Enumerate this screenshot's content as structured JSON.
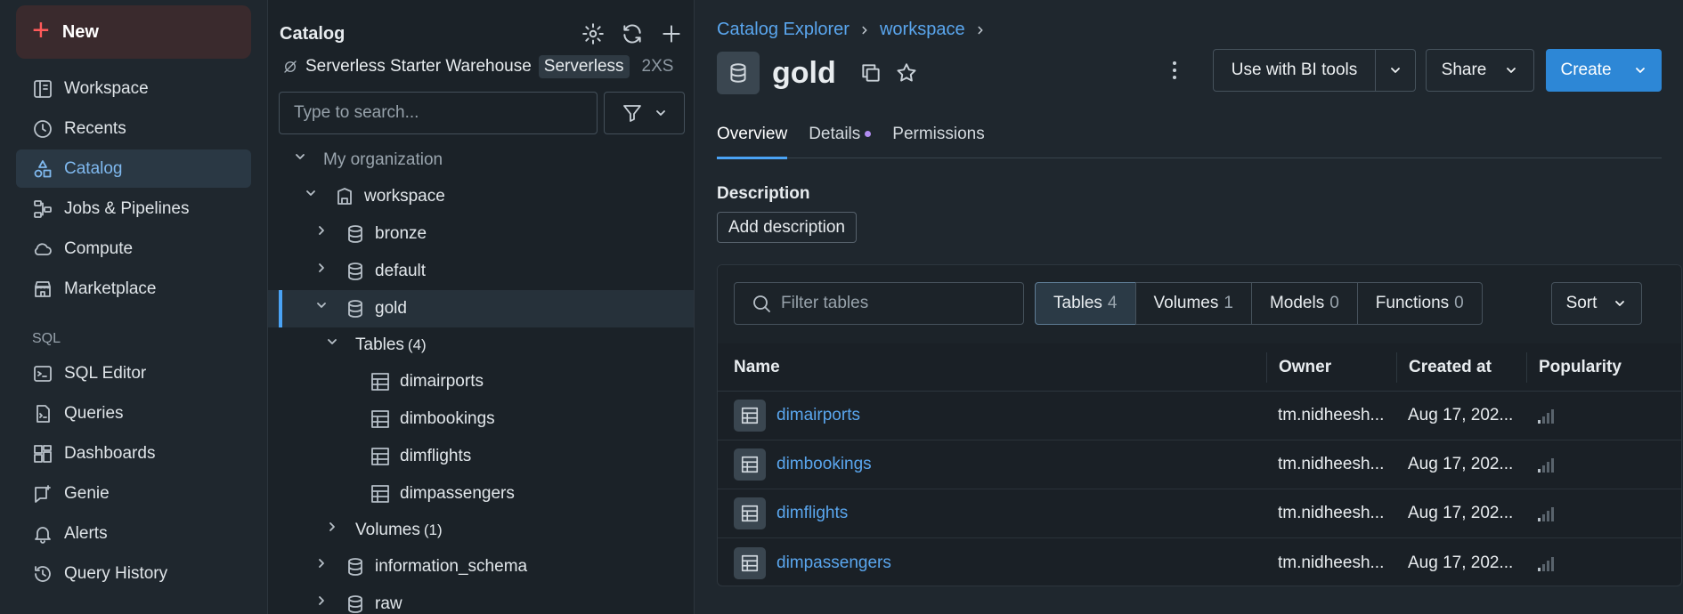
{
  "leftnav": {
    "new_label": "New",
    "items": [
      {
        "label": "Workspace",
        "icon": "workspace-icon"
      },
      {
        "label": "Recents",
        "icon": "clock-icon"
      },
      {
        "label": "Catalog",
        "icon": "catalog-icon",
        "active": true
      },
      {
        "label": "Jobs & Pipelines",
        "icon": "workflow-icon"
      },
      {
        "label": "Compute",
        "icon": "cloud-icon"
      },
      {
        "label": "Marketplace",
        "icon": "store-icon"
      }
    ],
    "sql_section": "SQL",
    "sql_items": [
      {
        "label": "SQL Editor",
        "icon": "terminal-icon"
      },
      {
        "label": "Queries",
        "icon": "file-code-icon"
      },
      {
        "label": "Dashboards",
        "icon": "dashboard-icon"
      },
      {
        "label": "Genie",
        "icon": "chat-icon"
      },
      {
        "label": "Alerts",
        "icon": "bell-icon"
      },
      {
        "label": "Query History",
        "icon": "history-icon"
      }
    ]
  },
  "catalog_panel": {
    "title": "Catalog",
    "warehouse": {
      "name": "Serverless Starter Warehouse",
      "badge": "Serverless",
      "size": "2XS"
    },
    "search_placeholder": "Type to search...",
    "tree": {
      "org": "My organization",
      "workspace": "workspace",
      "bronze": "bronze",
      "default": "default",
      "gold": "gold",
      "tables_label": "Tables",
      "tables_count": "(4)",
      "tables": [
        "dimairports",
        "dimbookings",
        "dimflights",
        "dimpassengers"
      ],
      "volumes_label": "Volumes",
      "volumes_count": "(1)",
      "information_schema": "information_schema",
      "raw": "raw"
    }
  },
  "main": {
    "breadcrumb": [
      "Catalog Explorer",
      "workspace"
    ],
    "title": "gold",
    "buttons": {
      "bi": "Use with BI tools",
      "share": "Share",
      "create": "Create"
    },
    "tabs": [
      "Overview",
      "Details",
      "Permissions"
    ],
    "description_label": "Description",
    "add_description": "Add description",
    "filter_placeholder": "Filter tables",
    "segments": [
      {
        "label": "Tables",
        "count": "4"
      },
      {
        "label": "Volumes",
        "count": "1"
      },
      {
        "label": "Models",
        "count": "0"
      },
      {
        "label": "Functions",
        "count": "0"
      }
    ],
    "sort_label": "Sort",
    "columns": {
      "name": "Name",
      "owner": "Owner",
      "created": "Created at",
      "popularity": "Popularity"
    },
    "rows": [
      {
        "name": "dimairports",
        "owner": "tm.nidheesh...",
        "created": "Aug 17, 202...",
        "popularity": 1
      },
      {
        "name": "dimbookings",
        "owner": "tm.nidheesh...",
        "created": "Aug 17, 202...",
        "popularity": 1
      },
      {
        "name": "dimflights",
        "owner": "tm.nidheesh...",
        "created": "Aug 17, 202...",
        "popularity": 1
      },
      {
        "name": "dimpassengers",
        "owner": "tm.nidheesh...",
        "created": "Aug 17, 202...",
        "popularity": 1
      }
    ]
  },
  "colors": {
    "accent": "#4aa3f5",
    "link": "#5aa6ee",
    "create_button": "#2d87d6",
    "new_plus": "#ff5a5a",
    "details_dot": "#b18cf0"
  }
}
